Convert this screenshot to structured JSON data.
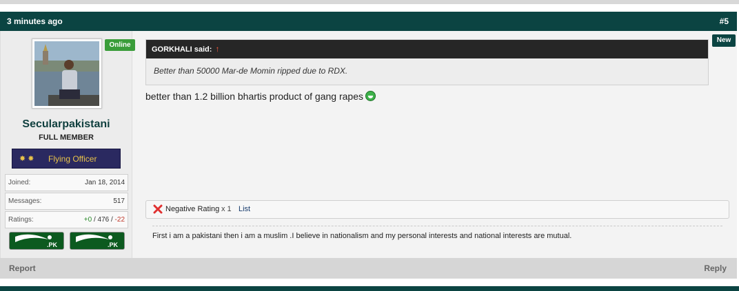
{
  "post": {
    "time_ago": "3 minutes ago",
    "post_number": "#5",
    "new_label": "New"
  },
  "user": {
    "online_label": "Online",
    "username": "Secularpakistani",
    "user_title": "FULL MEMBER",
    "rank": {
      "stars": "✸✸",
      "label": "Flying Officer"
    },
    "stats": {
      "joined_label": "Joined:",
      "joined": "Jan 18, 2014",
      "messages_label": "Messages:",
      "messages": "517",
      "ratings_label": "Ratings:",
      "ratings_pos": "+0",
      "ratings_sep1": " / ",
      "ratings_total": "476",
      "ratings_sep2": " / ",
      "ratings_neg": "-22"
    },
    "flags": [
      ".PK",
      ".PK"
    ]
  },
  "quote": {
    "author": "GORKHALI said:",
    "arrow": "↑",
    "text": "Better than 50000 Mar-de Momin ripped due to RDX."
  },
  "message": "better than 1.2 billion bhartis product of gang rapes",
  "ratings_bar": {
    "label": "Negative Rating",
    "count": "x 1",
    "list_link": "List"
  },
  "signature": "First i am a pakistani then i am a muslim .I believe in nationalism and my personal interests and national interests are mutual.",
  "footer": {
    "report": "Report",
    "reply": "Reply"
  },
  "colors": {
    "header": "#0b4442",
    "online": "#3a9d3a",
    "rank_bg": "#2a2960",
    "rank_text": "#e8c34a"
  }
}
